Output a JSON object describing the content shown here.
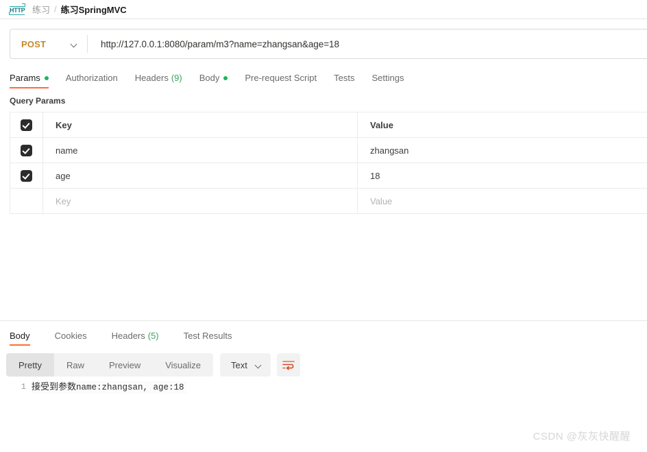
{
  "breadcrumb": {
    "icon": "http-protocol-icon",
    "collection": "练习",
    "separator": "/",
    "current": "练习SpringMVC"
  },
  "request": {
    "method": "POST",
    "method_color": "#c5892b",
    "url": "http://127.0.0.1:8080/param/m3?name=zhangsan&age=18",
    "tabs": [
      {
        "label": "Params",
        "dot": true,
        "active": true
      },
      {
        "label": "Authorization",
        "dot": false,
        "active": false
      },
      {
        "label": "Headers",
        "count": "(9)",
        "dot": false,
        "active": false
      },
      {
        "label": "Body",
        "dot": true,
        "active": false
      },
      {
        "label": "Pre-request Script",
        "dot": false,
        "active": false
      },
      {
        "label": "Tests",
        "dot": false,
        "active": false
      },
      {
        "label": "Settings",
        "dot": false,
        "active": false
      }
    ],
    "params_section_title": "Query Params",
    "params_columns": {
      "key": "Key",
      "value": "Value"
    },
    "params_rows": [
      {
        "checked": true,
        "key": "name",
        "value": "zhangsan"
      },
      {
        "checked": true,
        "key": "age",
        "value": "18"
      }
    ],
    "params_placeholder_row": {
      "key": "Key",
      "value": "Value"
    }
  },
  "response": {
    "tabs": [
      {
        "label": "Body",
        "active": true
      },
      {
        "label": "Cookies",
        "active": false
      },
      {
        "label": "Headers",
        "count": "(5)",
        "active": false
      },
      {
        "label": "Test Results",
        "active": false
      }
    ],
    "format_modes": [
      {
        "label": "Pretty",
        "active": true
      },
      {
        "label": "Raw",
        "active": false
      },
      {
        "label": "Preview",
        "active": false
      },
      {
        "label": "Visualize",
        "active": false
      }
    ],
    "content_type": "Text",
    "wrap_icon": "word-wrap-icon",
    "body_lines": [
      {
        "number": "1",
        "cjk": "接受到参数",
        "rest": "name:zhangsan, age:18"
      }
    ]
  },
  "colors": {
    "accent": "#ff6c37",
    "green": "#1cb65a",
    "method": "#c5892b",
    "icon_teal": "#2aa3a8"
  },
  "watermark": "CSDN @灰灰快醒醒"
}
